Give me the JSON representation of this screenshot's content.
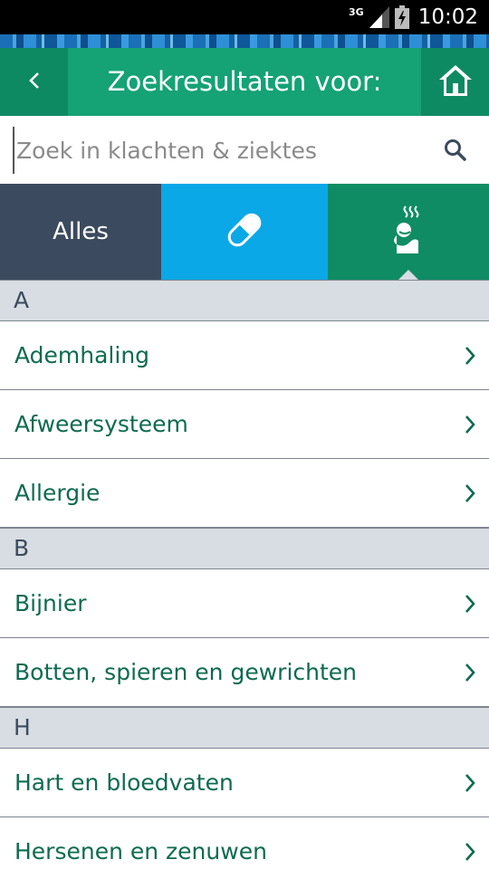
{
  "status_bar": {
    "network": "3G",
    "time": "10:02"
  },
  "header": {
    "title": "Zoekresultaten voor:",
    "back_icon": "chevron-left-icon",
    "home_icon": "home-icon"
  },
  "search": {
    "value": "",
    "placeholder": "Zoek in klachten & ziektes",
    "icon": "search-icon"
  },
  "tabs": {
    "all_label": "Alles",
    "medicine_icon": "pill-icon",
    "body_icon": "body-icon"
  },
  "colors": {
    "header_green": "#15a275",
    "header_dark_green": "#0e8a62",
    "tab_all": "#3b4a5e",
    "tab_medicine": "#0aa8e6",
    "tab_body": "#0f8c63",
    "list_text": "#0e6b4f",
    "section_bg": "#d8dde3"
  },
  "sections": [
    {
      "letter": "A",
      "items": [
        "Ademhaling",
        "Afweersysteem",
        "Allergie"
      ]
    },
    {
      "letter": "B",
      "items": [
        "Bijnier",
        "Botten, spieren en gewrichten"
      ]
    },
    {
      "letter": "H",
      "items": [
        "Hart en bloedvaten",
        "Hersenen en zenuwen"
      ]
    }
  ]
}
